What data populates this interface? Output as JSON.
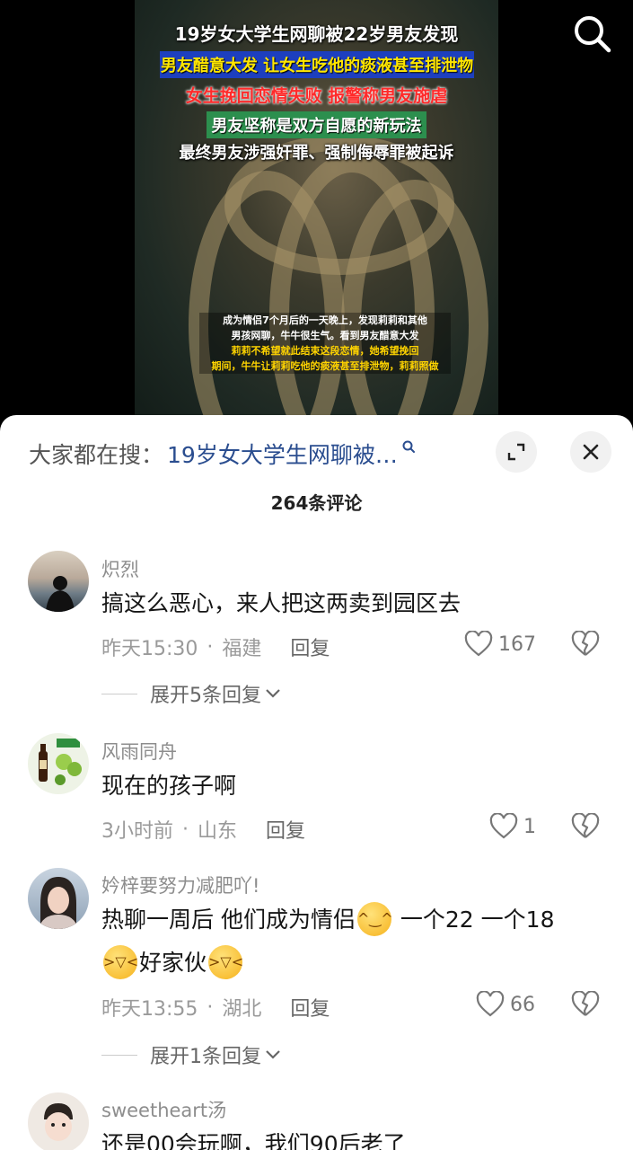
{
  "video": {
    "headlines": [
      "19岁女大学生网聊被22岁男友发现",
      "男友醋意大发 让女生吃他的痰液甚至排泄物",
      "女生挽回恋情失败 报警称男友施虐",
      "男友坚称是双方自愿的新玩法",
      "最终男友涉强奸罪、强制侮辱罪被起诉"
    ],
    "subtitle_lines": [
      "成为情侣7个月后的一天晚上，发现莉莉和其他",
      "男孩网聊，牛牛很生气。看到男友醋意大发",
      "莉莉不希望就此结束这段恋情，她希望挽回",
      "期间，牛牛让莉莉吃他的痰液甚至排泄物，莉莉照做"
    ]
  },
  "trending": {
    "label": "大家都在搜：",
    "query": "19岁女大学生网聊被…"
  },
  "comment_count": "264条评论",
  "comments": [
    {
      "user": "炽烈",
      "text": "搞这么恶心，来人把这两卖到园区去",
      "time": "昨天15:30",
      "location": "福建",
      "reply_label": "回复",
      "likes": "167",
      "expand_label": "展开5条回复"
    },
    {
      "user": "风雨同舟",
      "text": "现在的孩子啊",
      "time": "3小时前",
      "location": "山东",
      "reply_label": "回复",
      "likes": "1"
    },
    {
      "user": "妗梓要努力减肥吖!",
      "text_a": "热聊一周后 他们成为情侣",
      "text_b": " 一个22 一个18",
      "text_c": "好家伙",
      "time": "昨天13:55",
      "location": "湖北",
      "reply_label": "回复",
      "likes": "66",
      "expand_label": "展开1条回复"
    },
    {
      "user": "sweetheart汤",
      "text": "还是00会玩啊，我们90后老了"
    }
  ],
  "colors": {
    "query": "#2a4d8f",
    "username": "#8d8d8d",
    "meta": "#9a9a9a"
  },
  "icons": [
    "search-icon",
    "magnifier-icon",
    "expand-icon",
    "close-icon",
    "heart-icon",
    "broken-heart-icon",
    "chevron-down-icon",
    "sweat-smile-emoji",
    "crying-laugh-emoji"
  ]
}
